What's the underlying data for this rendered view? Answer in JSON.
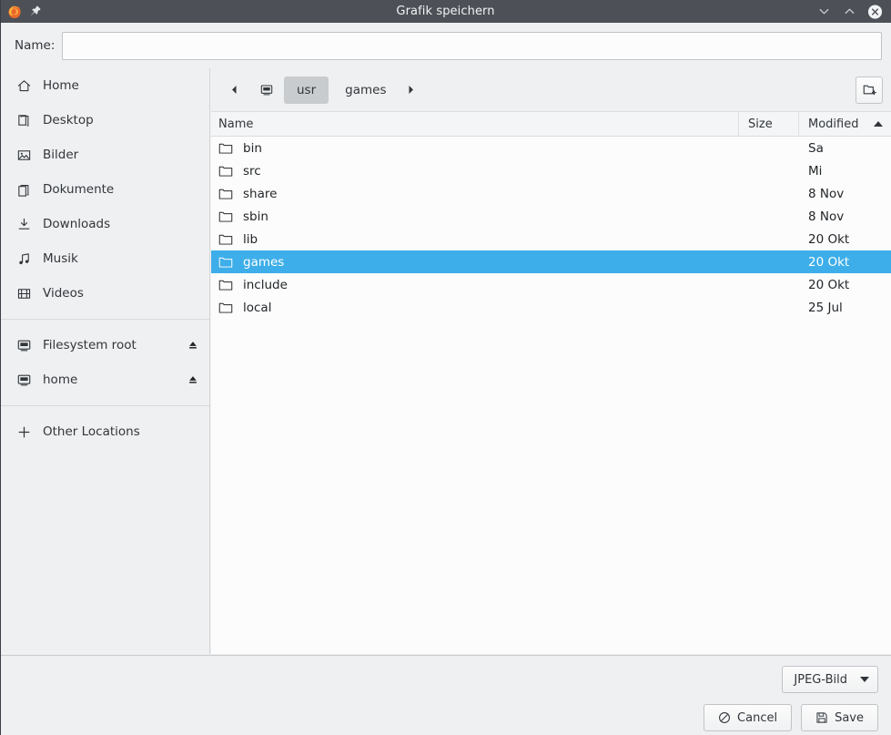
{
  "titlebar": {
    "title": "Grafik speichern",
    "app_icon": "firefox-icon",
    "pin_icon": "pin-icon",
    "minimize_icon": "chevron-down-icon",
    "maximize_icon": "chevron-up-icon",
    "close_icon": "close-icon"
  },
  "name_row": {
    "label": "Name:",
    "value": "",
    "placeholder": ""
  },
  "sidebar": {
    "places": [
      {
        "label": "Home",
        "icon": "home-icon"
      },
      {
        "label": "Desktop",
        "icon": "desktop-icon"
      },
      {
        "label": "Bilder",
        "icon": "pictures-icon"
      },
      {
        "label": "Dokumente",
        "icon": "documents-icon"
      },
      {
        "label": "Downloads",
        "icon": "downloads-icon"
      },
      {
        "label": "Musik",
        "icon": "music-icon"
      },
      {
        "label": "Videos",
        "icon": "videos-icon"
      }
    ],
    "devices": [
      {
        "label": "Filesystem root",
        "icon": "drive-icon",
        "eject": "eject-icon"
      },
      {
        "label": "home",
        "icon": "drive-icon",
        "eject": "eject-icon"
      }
    ],
    "other": {
      "label": "Other Locations",
      "icon": "plus-icon"
    }
  },
  "pathbar": {
    "back_icon": "caret-left-icon",
    "forward_icon": "caret-right-icon",
    "root_icon": "computer-icon",
    "crumbs": [
      {
        "label": "usr",
        "active": true
      },
      {
        "label": "games",
        "active": false
      }
    ],
    "new_folder_icon": "new-folder-icon"
  },
  "filelist": {
    "columns": [
      "Name",
      "Size",
      "Modified"
    ],
    "sort_column": "Modified",
    "sort_direction": "ascending",
    "rows": [
      {
        "name": "bin",
        "size": "",
        "modified": "Sa",
        "selected": false,
        "icon": "folder-icon"
      },
      {
        "name": "src",
        "size": "",
        "modified": "Mi",
        "selected": false,
        "icon": "folder-icon"
      },
      {
        "name": "share",
        "size": "",
        "modified": "8 Nov",
        "selected": false,
        "icon": "folder-icon"
      },
      {
        "name": "sbin",
        "size": "",
        "modified": "8 Nov",
        "selected": false,
        "icon": "folder-icon"
      },
      {
        "name": "lib",
        "size": "",
        "modified": "20 Okt",
        "selected": false,
        "icon": "folder-icon"
      },
      {
        "name": "games",
        "size": "",
        "modified": "20 Okt",
        "selected": true,
        "icon": "folder-icon"
      },
      {
        "name": "include",
        "size": "",
        "modified": "20 Okt",
        "selected": false,
        "icon": "folder-icon"
      },
      {
        "name": "local",
        "size": "",
        "modified": "25 Jul",
        "selected": false,
        "icon": "folder-icon"
      }
    ]
  },
  "footer": {
    "filetype": "JPEG-Bild",
    "cancel_label": "Cancel",
    "cancel_icon": "no-entry-icon",
    "save_label": "Save",
    "save_icon": "floppy-disk-icon"
  },
  "colors": {
    "titlebar_bg": "#4d5157",
    "selection_blue": "#3daee9",
    "chrome_bg": "#eff0f1",
    "list_bg": "#fcfcfc",
    "text": "#31363b"
  }
}
